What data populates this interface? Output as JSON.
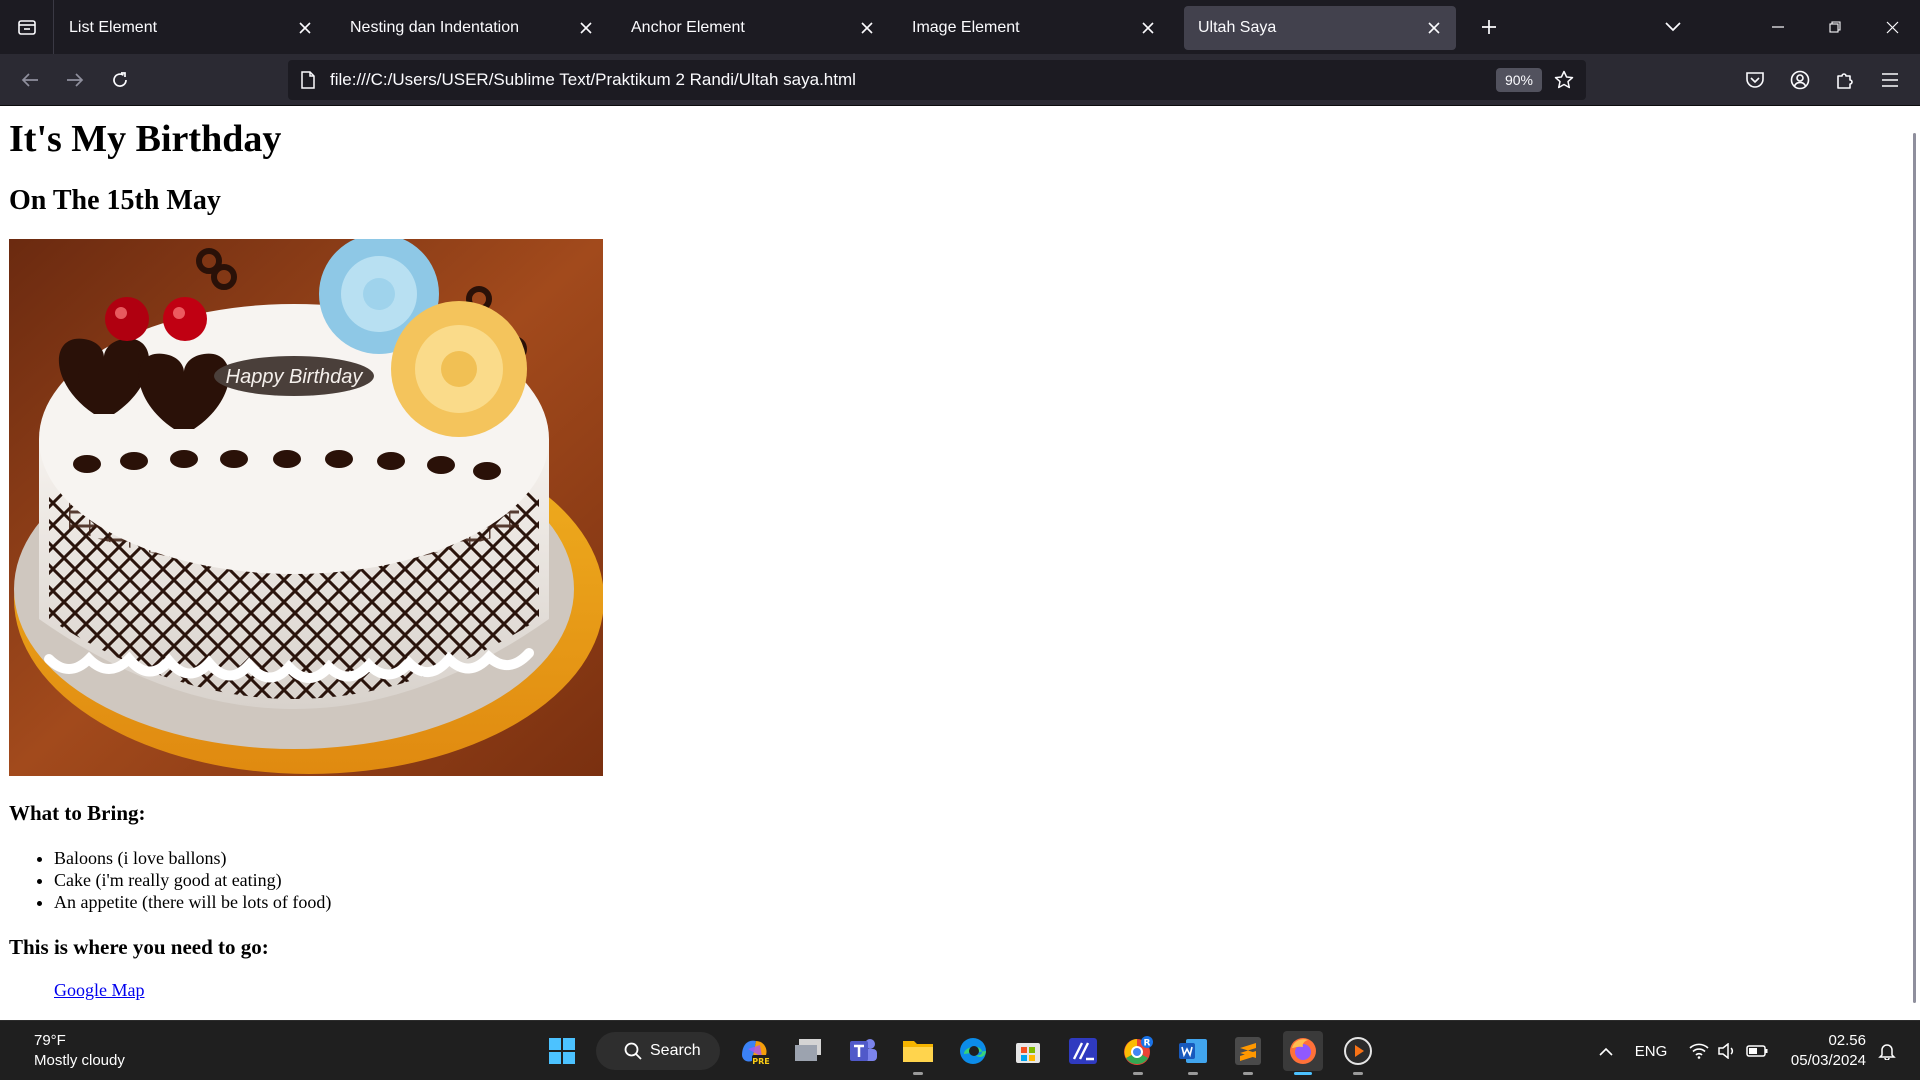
{
  "browser": {
    "tabs": [
      {
        "label": "List Element",
        "active": false
      },
      {
        "label": "Nesting dan Indentation",
        "active": false
      },
      {
        "label": "Anchor Element",
        "active": false
      },
      {
        "label": "Image Element",
        "active": false
      },
      {
        "label": "Ultah Saya",
        "active": true
      }
    ],
    "url": "file:///C:/Users/USER/Sublime Text/Praktikum 2 Randi/Ultah saya.html",
    "zoom": "90%"
  },
  "page": {
    "title": "It's My Birthday",
    "subtitle": "On The 15th May",
    "cake_text": "Happy Birthday",
    "bring_heading": "What to Bring:",
    "bring_items": [
      "Baloons (i love ballons)",
      "Cake (i'm really good at eating)",
      "An appetite (there will be lots of food)"
    ],
    "go_heading": "This is where you need to go:",
    "map_link": "Google Map"
  },
  "taskbar": {
    "weather_temp": "79°F",
    "weather_desc": "Mostly cloudy",
    "search_label": "Search",
    "language": "ENG",
    "time": "02.56",
    "date": "05/03/2024",
    "copilot_badge": "PRE",
    "chrome_badge": "R"
  },
  "colors": {
    "tabbar_bg": "#1c1b22",
    "navbar_bg": "#2b2a33",
    "active_tab": "#42414d",
    "link": "#0000ee",
    "taskbar_bg": "#1f1f1f"
  }
}
